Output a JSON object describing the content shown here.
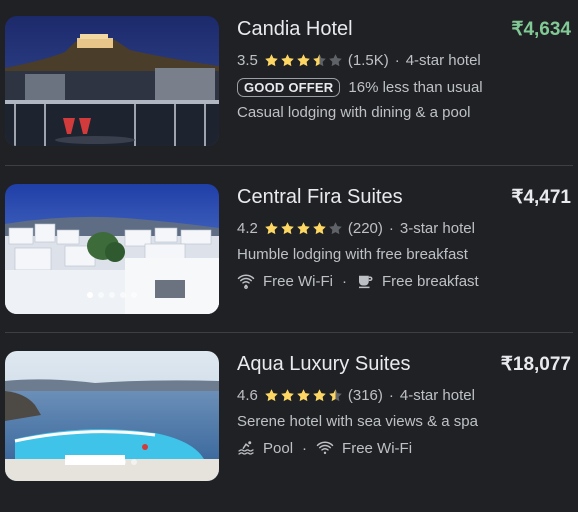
{
  "hotels": [
    {
      "name": "Candia Hotel",
      "price": "₹4,634",
      "price_is_deal": true,
      "rating": "3.5",
      "rating_value": 3.5,
      "reviews": "(1.5K)",
      "class_sep": "·",
      "hotel_class": "4-star hotel",
      "badge": "GOOD OFFER",
      "offer_text": "16% less than usual",
      "description": "Casual lodging with dining & a pool",
      "photo_dots": 0
    },
    {
      "name": "Central Fira Suites",
      "price": "₹4,471",
      "price_is_deal": false,
      "rating": "4.2",
      "rating_value": 4.2,
      "reviews": "(220)",
      "class_sep": "·",
      "hotel_class": "3-star hotel",
      "description": "Humble lodging with free breakfast",
      "amenities": [
        {
          "icon": "wifi-icon",
          "label": "Free Wi-Fi"
        },
        {
          "icon": "breakfast-icon",
          "label": "Free breakfast"
        }
      ],
      "amenity_sep": "·",
      "photo_dots": 5
    },
    {
      "name": "Aqua Luxury Suites",
      "price": "₹18,077",
      "price_is_deal": false,
      "rating": "4.6",
      "rating_value": 4.6,
      "reviews": "(316)",
      "class_sep": "·",
      "hotel_class": "4-star hotel",
      "description": "Serene hotel with sea views & a spa",
      "amenities": [
        {
          "icon": "pool-icon",
          "label": "Pool"
        },
        {
          "icon": "wifi-icon",
          "label": "Free Wi-Fi"
        }
      ],
      "amenity_sep": "·",
      "photo_dots": 5
    }
  ],
  "colors": {
    "background": "#202124",
    "star": "#fdd663",
    "star_empty": "#5f6368",
    "deal_price": "#81c995",
    "text_primary": "#e8eaed",
    "text_secondary": "#bdc1c6"
  }
}
